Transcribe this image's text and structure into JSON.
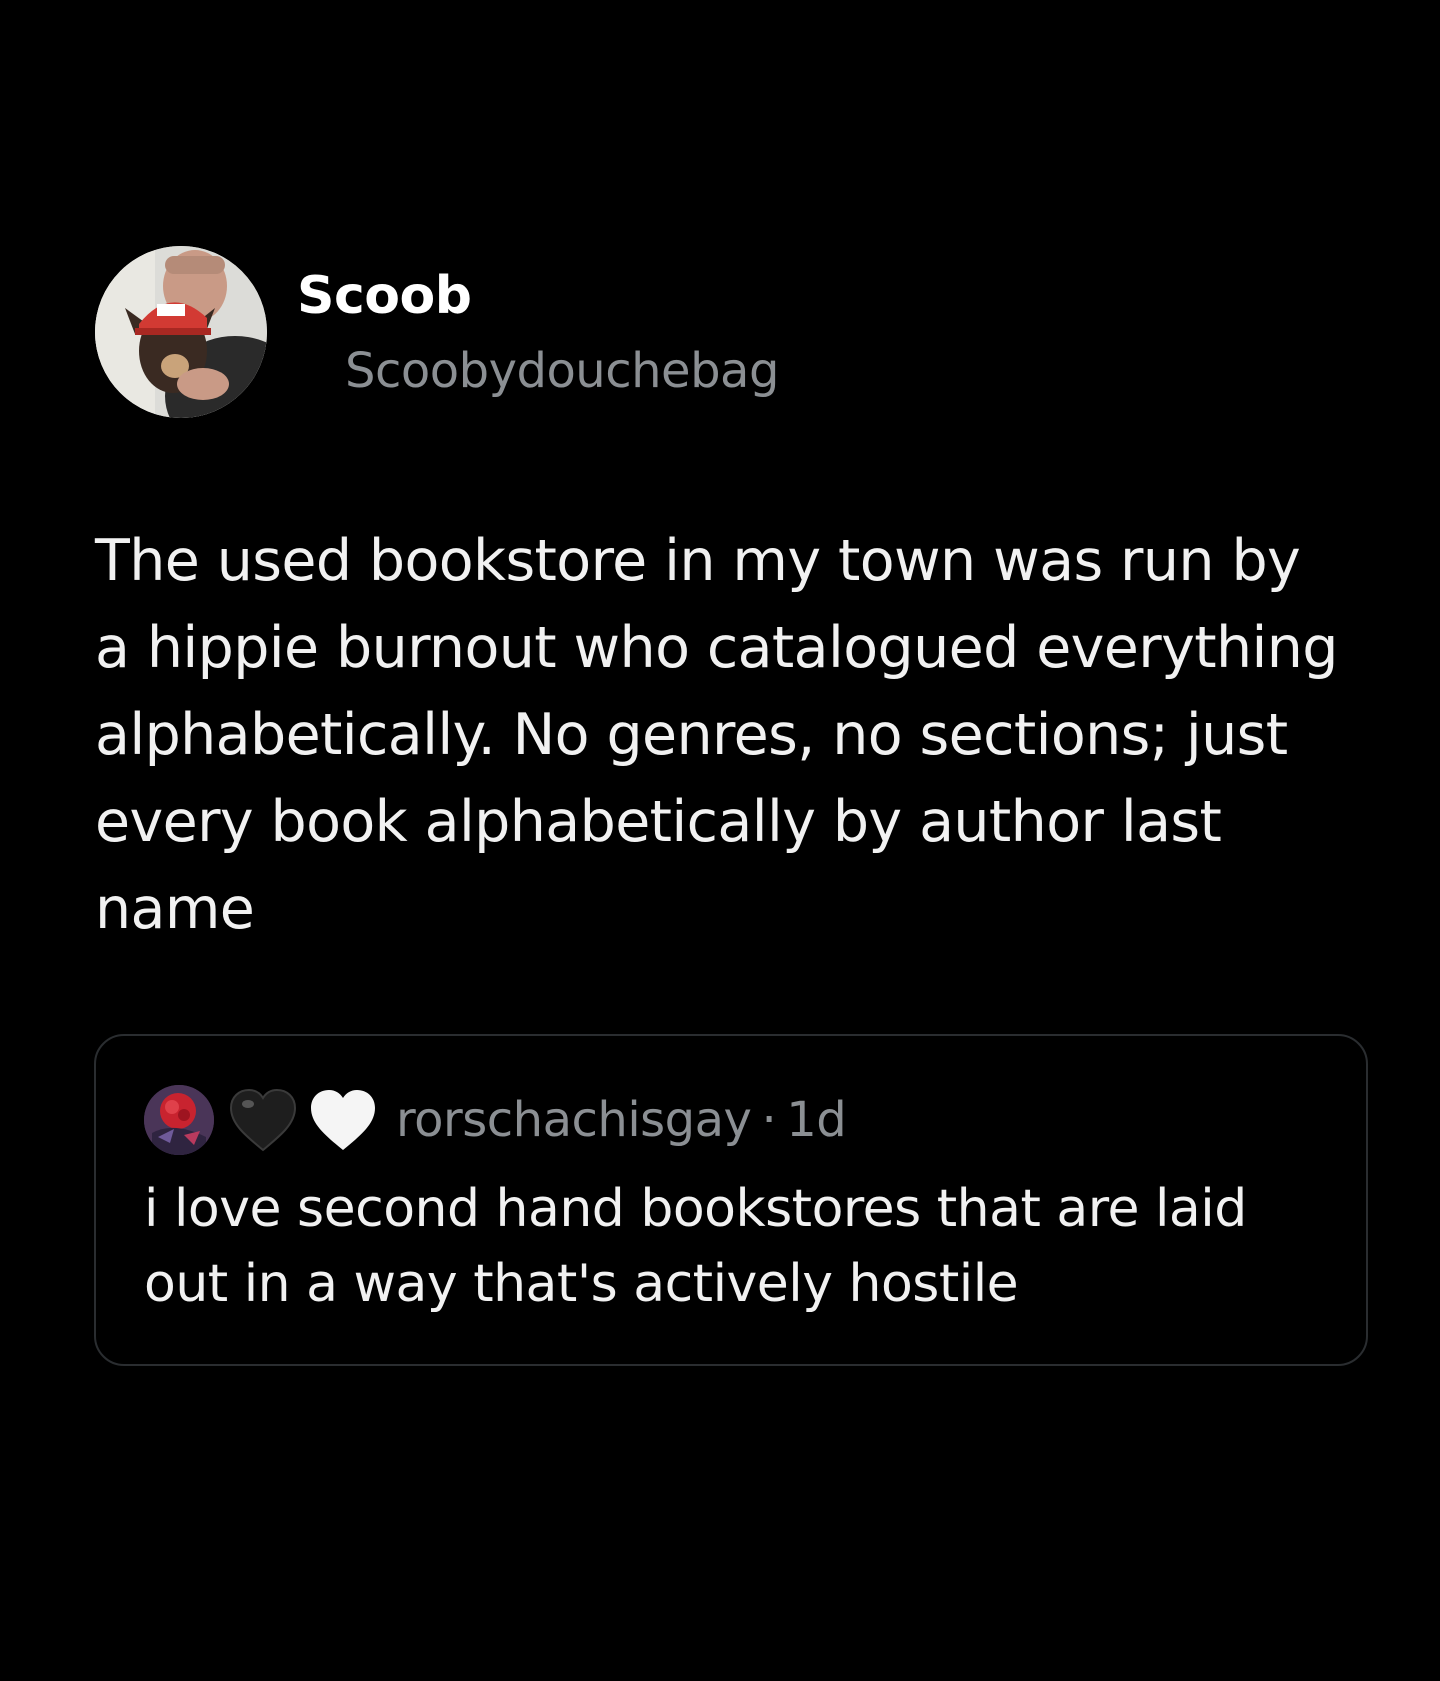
{
  "post": {
    "author": {
      "display_name": "Scoob",
      "handle": "Scoobydouchebag",
      "avatar_icon": "profile-photo"
    },
    "text": "The used bookstore in my town was run by\na hippie burnout who catalogued everything\nalphabetically. No genres, no sections; just\nevery book alphabetically by author last\nname"
  },
  "quote": {
    "avatar_icon": "profile-photo",
    "heart_icons": [
      "black-heart-icon",
      "white-heart-icon"
    ],
    "handle": "rorschachisgay",
    "separator": "·",
    "time": "1d",
    "text": "i love second hand bookstores that are laid\nout in a way that's actively hostile"
  },
  "colors": {
    "background": "#000000",
    "primary_text": "#f1f1f1",
    "secondary_text": "#8b8f93",
    "card_border": "#2a2d30"
  }
}
